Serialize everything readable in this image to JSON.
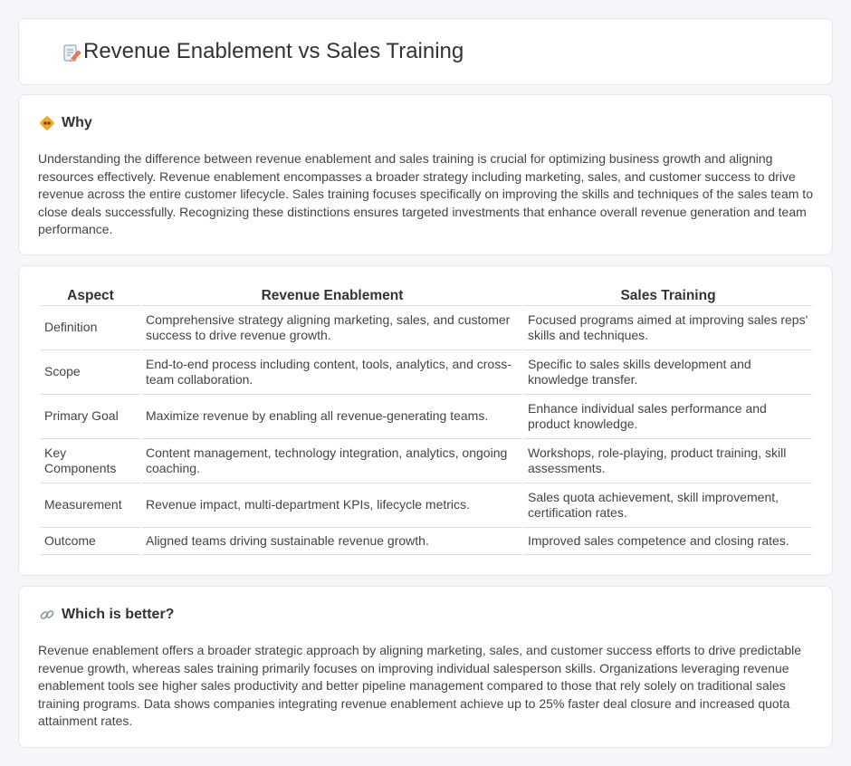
{
  "header": {
    "title": "Revenue Enablement vs Sales Training",
    "icon": "document-pencil-icon"
  },
  "why": {
    "title": "Why",
    "icon": "handshake-diamond-icon",
    "text": "Understanding the difference between revenue enablement and sales training is crucial for optimizing business growth and aligning resources effectively. Revenue enablement encompasses a broader strategy including marketing, sales, and customer success to drive revenue across the entire customer lifecycle. Sales training focuses specifically on improving the skills and techniques of the sales team to close deals successfully. Recognizing these distinctions ensures targeted investments that enhance overall revenue generation and team performance."
  },
  "comparison": {
    "headers": [
      "Aspect",
      "Revenue Enablement",
      "Sales Training"
    ],
    "rows": [
      [
        "Definition",
        "Comprehensive strategy aligning marketing, sales, and customer success to drive revenue growth.",
        "Focused programs aimed at improving sales reps' skills and techniques."
      ],
      [
        "Scope",
        "End-to-end process including content, tools, analytics, and cross-team collaboration.",
        "Specific to sales skills development and knowledge transfer."
      ],
      [
        "Primary Goal",
        "Maximize revenue by enabling all revenue-generating teams.",
        "Enhance individual sales performance and product knowledge."
      ],
      [
        "Key Components",
        "Content management, technology integration, analytics, ongoing coaching.",
        "Workshops, role-playing, product training, skill assessments."
      ],
      [
        "Measurement",
        "Revenue impact, multi-department KPIs, lifecycle metrics.",
        "Sales quota achievement, skill improvement, certification rates."
      ],
      [
        "Outcome",
        "Aligned teams driving sustainable revenue growth.",
        "Improved sales competence and closing rates."
      ]
    ]
  },
  "better": {
    "title": "Which is better?",
    "icon": "link-icon",
    "text": "Revenue enablement offers a broader strategic approach by aligning marketing, sales, and customer success efforts to drive predictable revenue growth, whereas sales training primarily focuses on improving individual salesperson skills. Organizations leveraging revenue enablement tools see higher sales productivity and better pipeline management compared to those that rely solely on traditional sales training programs. Data shows companies integrating revenue enablement achieve up to 25% faster deal closure and increased quota attainment rates."
  }
}
